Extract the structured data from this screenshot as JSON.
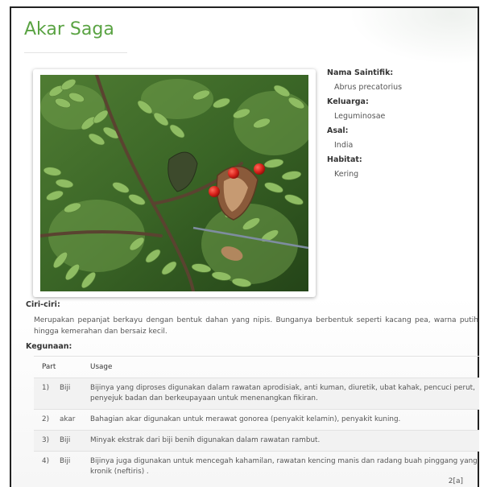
{
  "page": {
    "title": "Akar Saga"
  },
  "photo": {
    "icon": "abrus-precatorius-photo"
  },
  "info": [
    {
      "label": "Nama Saintifik:",
      "value": "Abrus precatorius"
    },
    {
      "label": "Keluarga:",
      "value": "Leguminosae"
    },
    {
      "label": "Asal:",
      "value": "India"
    },
    {
      "label": "Habitat:",
      "value": "Kering"
    }
  ],
  "ciri": {
    "heading": "Ciri-ciri:",
    "text": "Merupakan pepanjat berkayu dengan bentuk dahan yang nipis. Bunganya berbentuk seperti kacang pea, warna putih hingga kemerahan dan bersaiz kecil."
  },
  "kegunaan": {
    "heading": "Kegunaan:",
    "columns": [
      "Part",
      "Usage"
    ],
    "rows": [
      {
        "num": "1)",
        "part": "Biji",
        "usage": "Bijinya yang diproses digunakan dalam rawatan aprodisiak, anti kuman, diuretik, ubat kahak, pencuci perut, penyejuk badan dan berkeupayaan untuk menenangkan fikiran."
      },
      {
        "num": "2)",
        "part": "akar",
        "usage": "Bahagian akar digunakan untuk merawat gonorea (penyakit kelamin), penyakit kuning."
      },
      {
        "num": "3)",
        "part": "Biji",
        "usage": "Minyak ekstrak dari biji benih digunakan dalam rawatan rambut."
      },
      {
        "num": "4)",
        "part": "Biji",
        "usage": "Bijinya juga digunakan untuk mencegah kahamilan, rawatan kencing manis dan radang buah pinggang yang kronik (neftiris) ."
      }
    ]
  },
  "pager": {
    "text": "2[a]"
  }
}
